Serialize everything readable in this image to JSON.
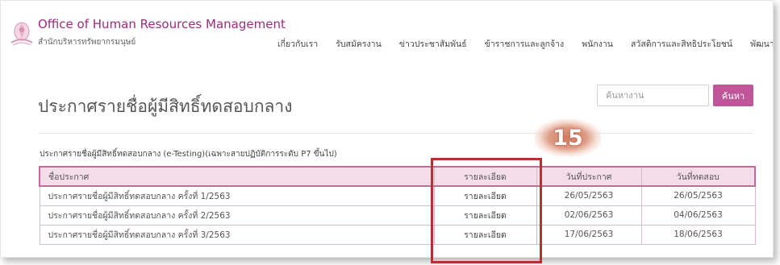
{
  "header": {
    "logo_en": "Office of Human Resources Management",
    "logo_th": "สำนักบริหารทรัพยากรมนุษย์",
    "nav": [
      {
        "label": "เกี่ยวกับเรา"
      },
      {
        "label": "รับสมัครงาน"
      },
      {
        "label": "ข่าวประชาสัมพันธ์"
      },
      {
        "label": "ข้าราชการและลูกจ้าง"
      },
      {
        "label": "พนักงาน"
      },
      {
        "label": "สวัสดิการและสิทธิประโยชน์"
      },
      {
        "label": "พัฒนาบุคลากร"
      }
    ]
  },
  "search": {
    "placeholder": "ค้นหางาน",
    "button_label": "ค้นหา"
  },
  "page": {
    "title": "ประกาศรายชื่อผู้มีสิทธิ์ทดสอบกลาง",
    "section_heading": "ประกาศรายชื่อผู้มีสิทธิ์ทดสอบกลาง (e-Testing)(เฉพาะสายปฏิบัติการระดับ P7 ขึ้นไป)"
  },
  "table": {
    "columns": [
      "ชื่อประกาศ",
      "รายละเอียด",
      "วันที่ประกาศ",
      "วันที่ทดสอบ"
    ],
    "rows": [
      {
        "name": "ประกาศรายชื่อผู้มีสิทธิ์ทดสอบกลาง ครั้งที่ 1/2563",
        "detail": "รายละเอียด",
        "announce_date": "26/05/2563",
        "test_date": "26/05/2563"
      },
      {
        "name": "ประกาศรายชื่อผู้มีสิทธิ์ทดสอบกลาง ครั้งที่ 2/2563",
        "detail": "รายละเอียด",
        "announce_date": "02/06/2563",
        "test_date": "04/06/2563"
      },
      {
        "name": "ประกาศรายชื่อผู้มีสิทธิ์ทดสอบกลาง ครั้งที่ 3/2563",
        "detail": "รายละเอียด",
        "announce_date": "17/06/2563",
        "test_date": "18/06/2563"
      }
    ]
  },
  "annotation": {
    "step_number": "15",
    "highlight_color": "#b5322f"
  },
  "colors": {
    "brand": "#9a2c7d",
    "accent": "#c0569a",
    "table_header_bg": "#f4dde8"
  }
}
